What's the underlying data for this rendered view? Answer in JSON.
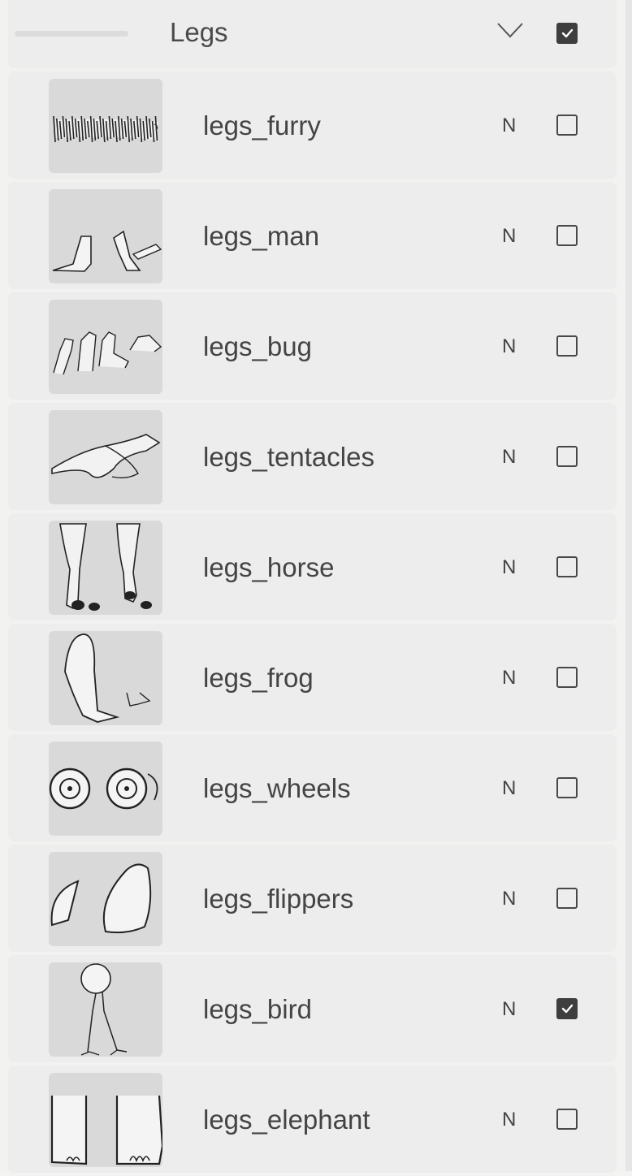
{
  "group": {
    "title": "Legs",
    "visible": true
  },
  "layers": [
    {
      "name": "legs_furry",
      "blend": "N",
      "visible": false,
      "thumb": "furry-legs-thumbnail"
    },
    {
      "name": "legs_man",
      "blend": "N",
      "visible": false,
      "thumb": "human-legs-thumbnail"
    },
    {
      "name": "legs_bug",
      "blend": "N",
      "visible": false,
      "thumb": "bug-legs-thumbnail"
    },
    {
      "name": "legs_tentacles",
      "blend": "N",
      "visible": false,
      "thumb": "tentacles-thumbnail"
    },
    {
      "name": "legs_horse",
      "blend": "N",
      "visible": false,
      "thumb": "horse-legs-thumbnail"
    },
    {
      "name": "legs_frog",
      "blend": "N",
      "visible": false,
      "thumb": "frog-legs-thumbnail"
    },
    {
      "name": "legs_wheels",
      "blend": "N",
      "visible": false,
      "thumb": "wheels-thumbnail"
    },
    {
      "name": "legs_flippers",
      "blend": "N",
      "visible": false,
      "thumb": "flippers-thumbnail"
    },
    {
      "name": "legs_bird",
      "blend": "N",
      "visible": true,
      "thumb": "bird-legs-thumbnail"
    },
    {
      "name": "legs_elephant",
      "blend": "N",
      "visible": false,
      "thumb": "elephant-legs-thumbnail"
    }
  ],
  "colors": {
    "panel_bg": "#f2f2f1",
    "row_bg": "#ecedec",
    "thumb_bg": "#d9d9d9",
    "checkbox": "#3e3e3e"
  }
}
